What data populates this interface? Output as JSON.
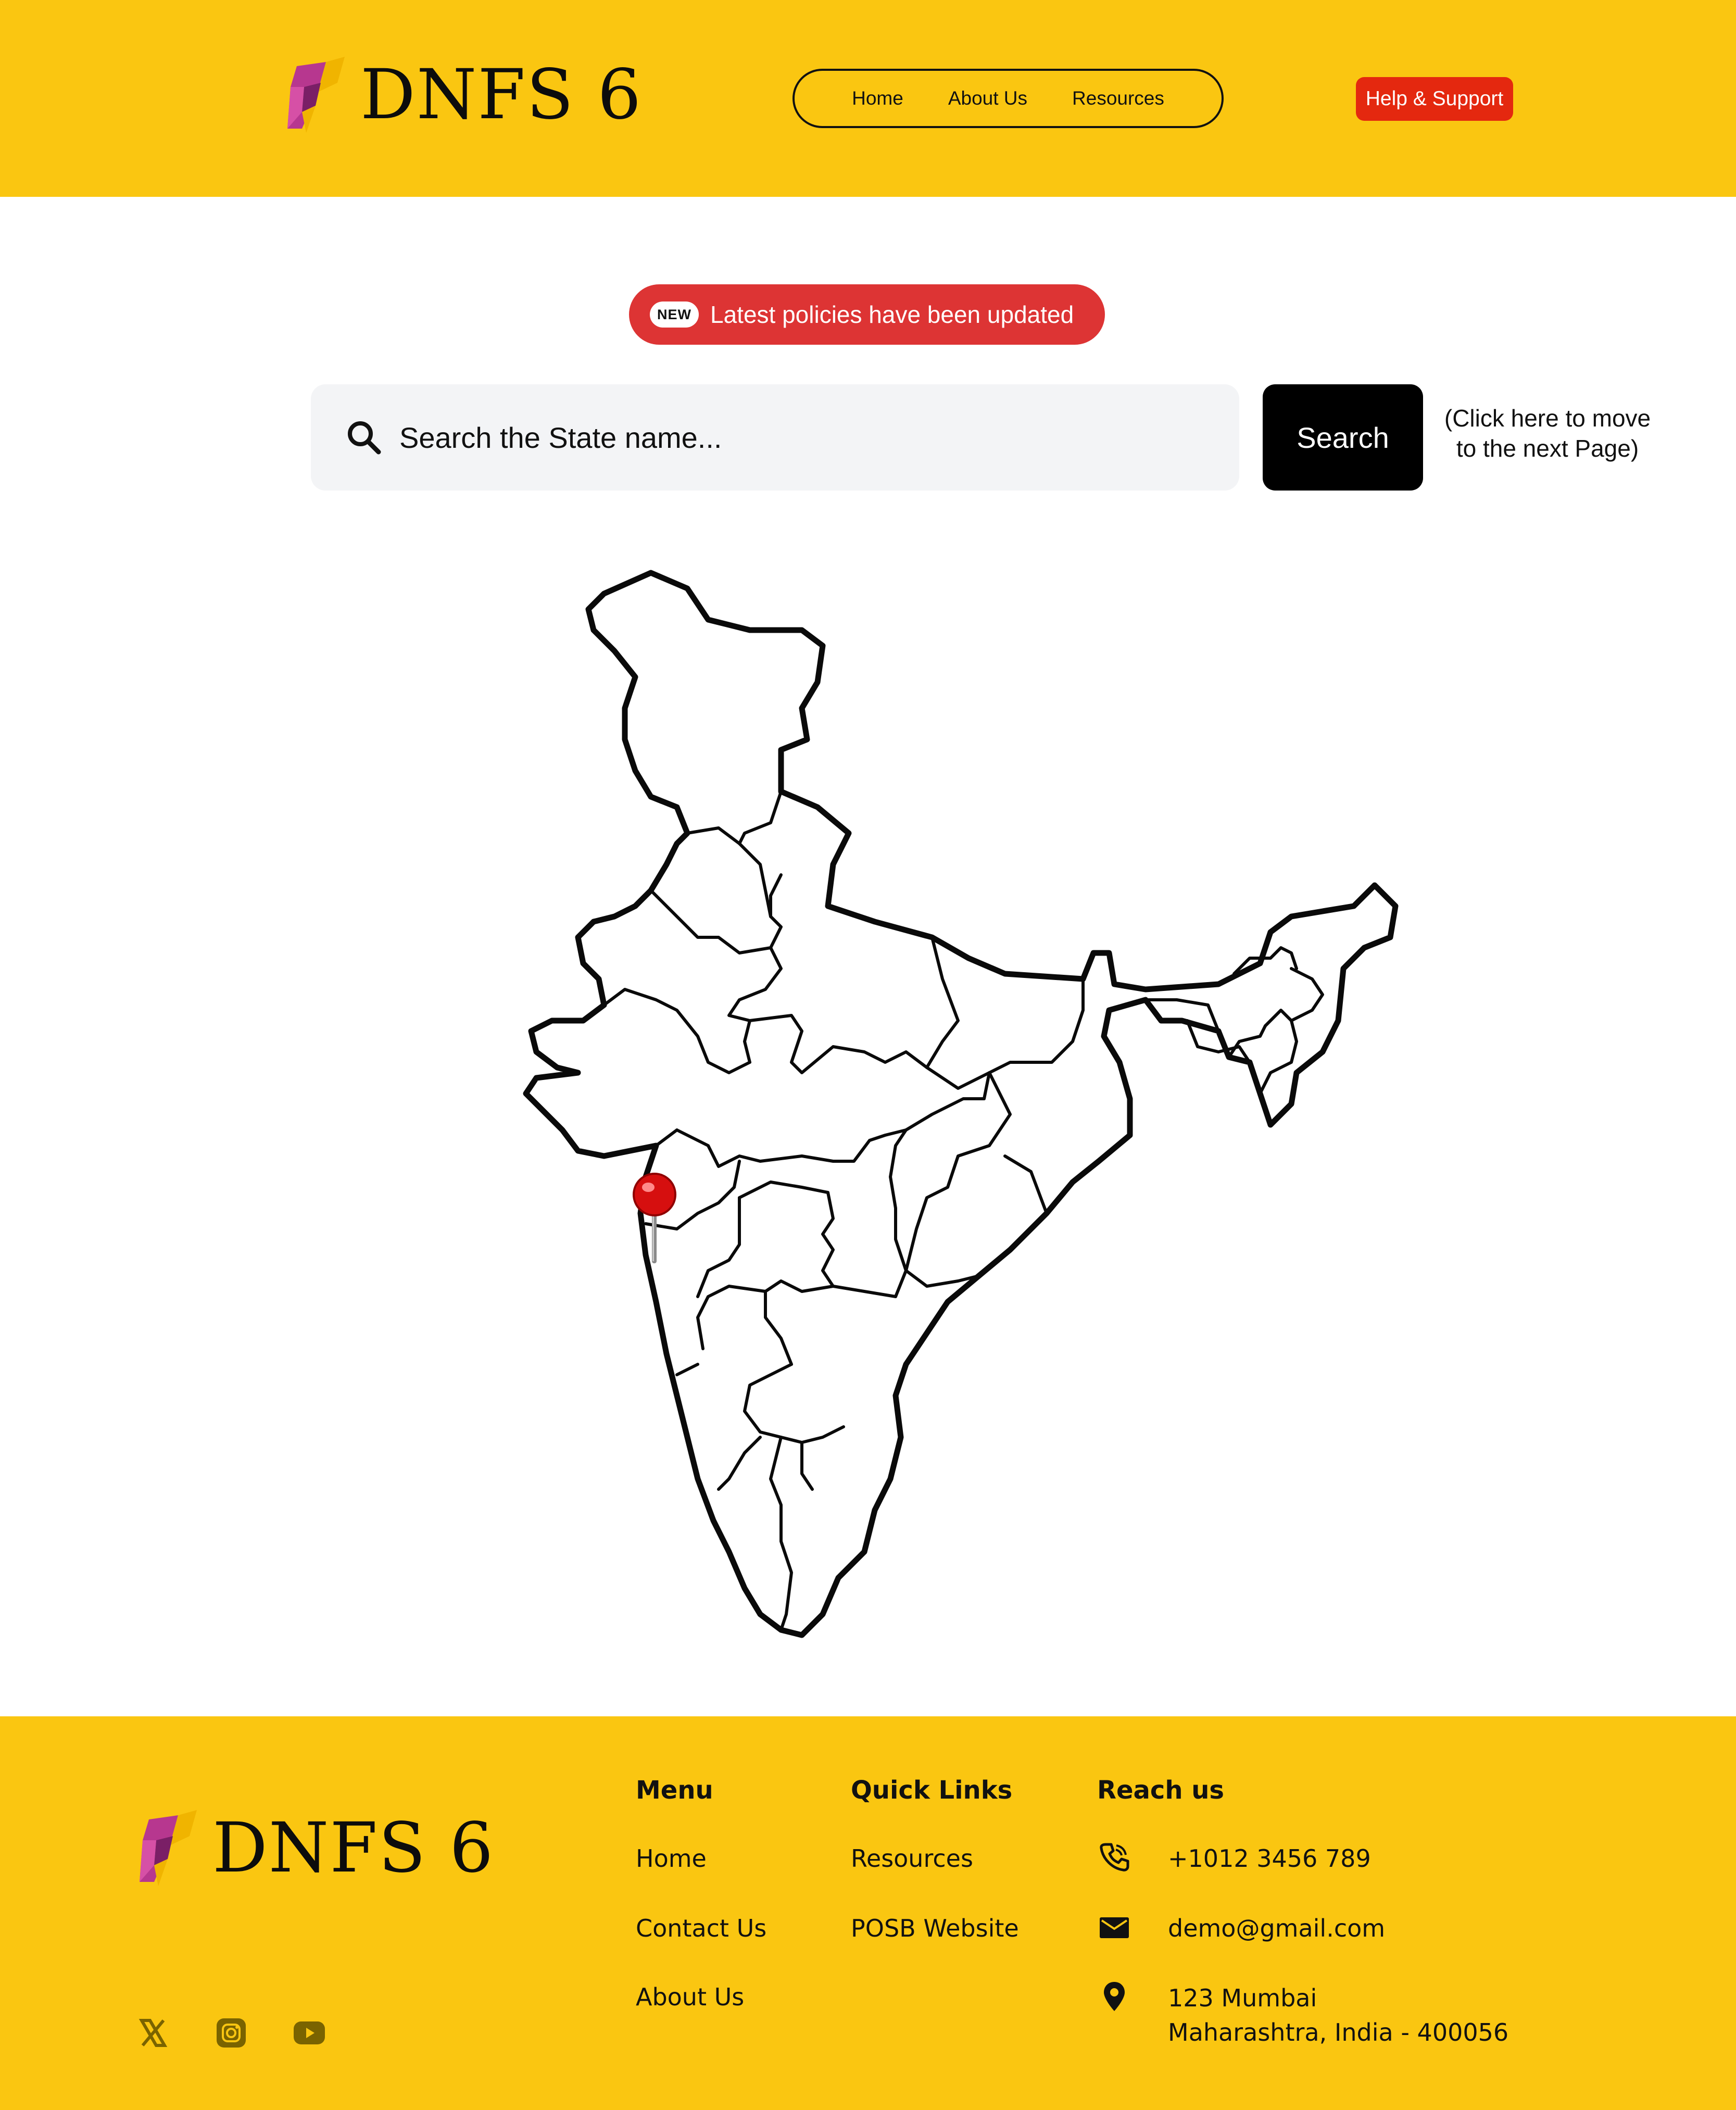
{
  "brand": {
    "name": "DNFS 6"
  },
  "header": {
    "nav": {
      "home": "Home",
      "about": "About Us",
      "resources": "Resources"
    },
    "help_label": "Help & Support"
  },
  "banner": {
    "badge": "NEW",
    "text": "Latest policies have been updated"
  },
  "search": {
    "placeholder": "Search the State name...",
    "button_label": "Search",
    "hint_line1": "(Click here to move",
    "hint_line2": "to the next Page)"
  },
  "map": {
    "subject": "India state map",
    "marker": "red-pushpin"
  },
  "footer": {
    "menu": {
      "title": "Menu",
      "items": [
        "Home",
        "Contact Us",
        "About Us"
      ]
    },
    "quick_links": {
      "title": "Quick Links",
      "items": [
        "Resources",
        "POSB Website"
      ]
    },
    "reach_us": {
      "title": "Reach us",
      "phone": "+1012 3456 789",
      "email": "demo@gmail.com",
      "address_line1": "123 Mumbai",
      "address_line2": "Maharashtra, India - 400056"
    },
    "social_icons": [
      "x-icon",
      "instagram-icon",
      "youtube-icon"
    ]
  },
  "colors": {
    "brand_yellow": "#FAC611",
    "help_red": "#E4280F",
    "banner_red": "#DD3434",
    "logo_magenta": "#B7378F",
    "logo_gold": "#F0B400"
  }
}
